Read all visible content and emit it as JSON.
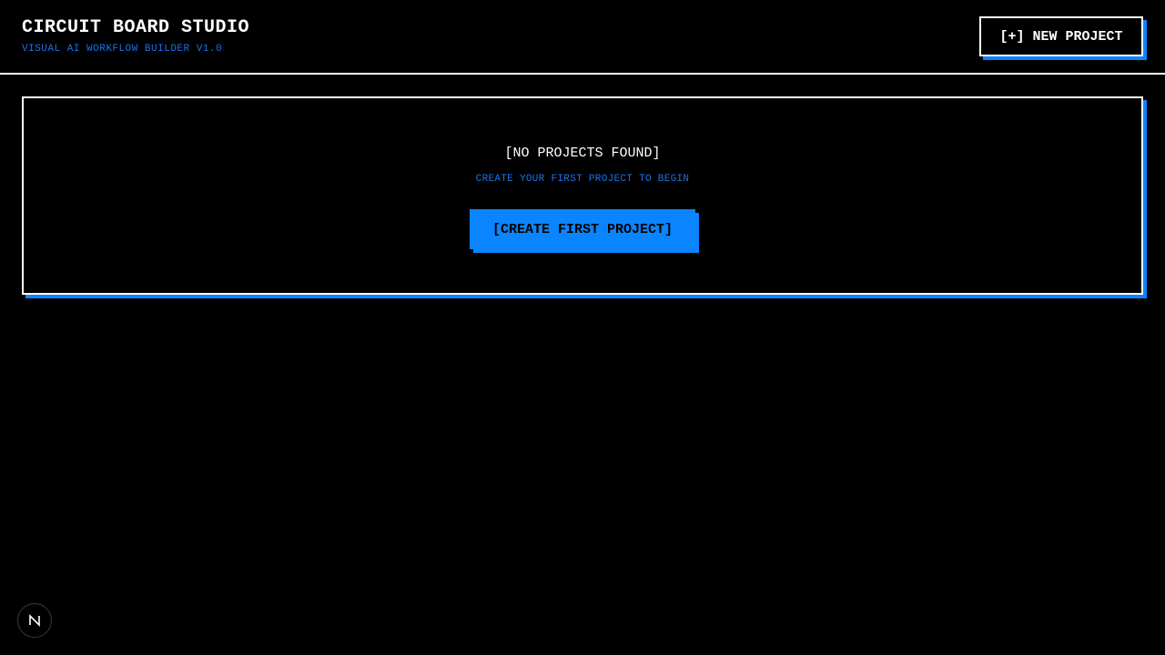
{
  "header": {
    "title": "CIRCUIT BOARD STUDIO",
    "subtitle": "VISUAL AI WORKFLOW BUILDER V1.0",
    "new_project_label": "[+] NEW PROJECT"
  },
  "main": {
    "empty_title": "[NO PROJECTS FOUND]",
    "empty_subtitle": "CREATE YOUR FIRST PROJECT TO BEGIN",
    "create_button_label": "[CREATE FIRST PROJECT]"
  },
  "badge": {
    "icon": "n-logo-icon"
  },
  "colors": {
    "background": "#000000",
    "accent": "#0a84ff",
    "text": "#ffffff",
    "subtle_blue": "#1a73e8"
  }
}
